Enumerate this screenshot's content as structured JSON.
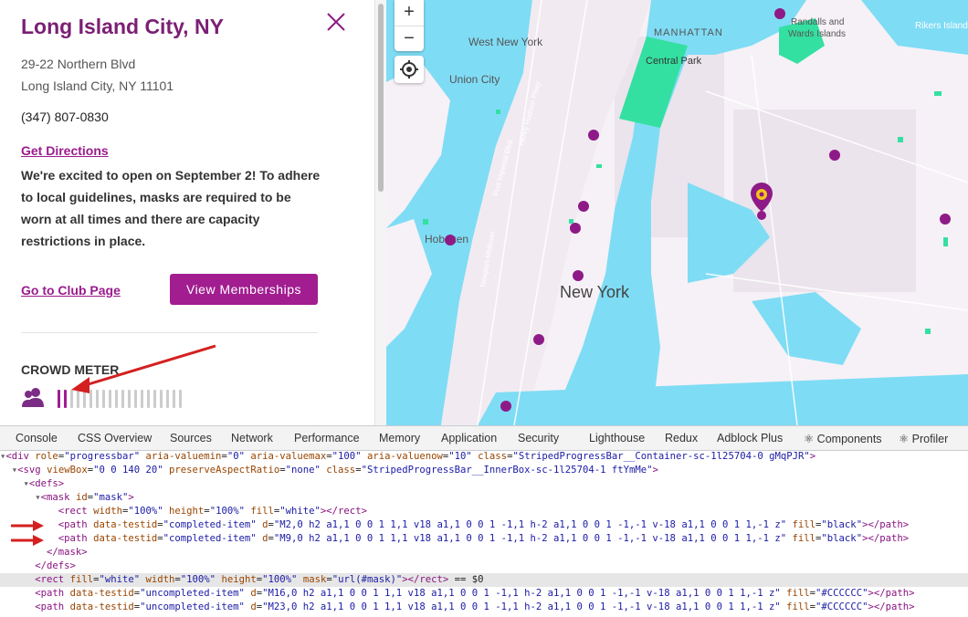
{
  "club": {
    "title": "Long Island City, NY",
    "address_line1": "29-22 Northern Blvd",
    "address_line2": "Long Island City, NY 11101",
    "phone": "(347) 807-0830",
    "directions_label": "Get Directions",
    "notice": "We're excited to open on September 2! To adhere to local guidelines, masks are required to be worn at all times and there are capacity restrictions in place.",
    "club_page_label": "Go to Club Page",
    "memberships_label": "View Memberships",
    "crowd_label": "CROWD METER",
    "crowd_level": 0.1
  },
  "map": {
    "labels": {
      "west_new_york": "West New York",
      "manhattan": "MANHATTAN",
      "central_park": "Central Park",
      "union_city": "Union City",
      "randalls": "Randalls and",
      "wards": "Wards Islands",
      "rikers": "Rikers Island",
      "hoboken": "Hoboken",
      "new_york": "New York",
      "henry_hudson": "Henry Hudson Pkwy",
      "fort_imperial": "Port Imperial Blvd",
      "newport": "Newport-Midtown"
    },
    "zoom_in": "+",
    "zoom_out": "−"
  },
  "devtools": {
    "tabs": [
      "Console",
      "CSS Overview",
      "Sources",
      "Network",
      "Performance",
      "Memory",
      "Application",
      "Security",
      "Lighthouse",
      "Redux",
      "Adblock Plus",
      "⚛ Components",
      "⚛ Profiler"
    ]
  },
  "colors": {
    "brand": "#a11d90",
    "title": "#7b1f74",
    "water": "#7fdcf5",
    "park": "#34e0a1",
    "pin": "#8e1a87"
  }
}
